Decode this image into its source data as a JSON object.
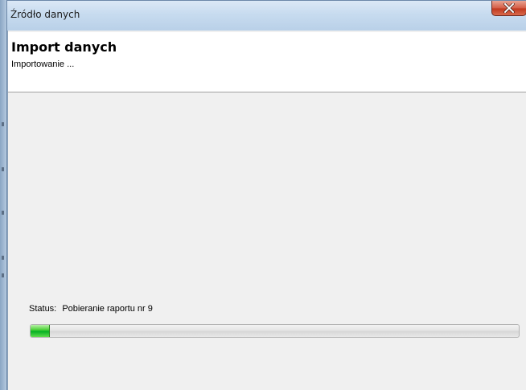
{
  "window": {
    "title": "Źródło danych",
    "close_icon": "close-icon"
  },
  "header": {
    "heading": "Import danych",
    "subtitle": "Importowanie ..."
  },
  "status": {
    "label": "Status:",
    "value": "Pobieranie raportu nr 9"
  },
  "progress": {
    "fraction": 0.04,
    "color": "#06b025"
  }
}
